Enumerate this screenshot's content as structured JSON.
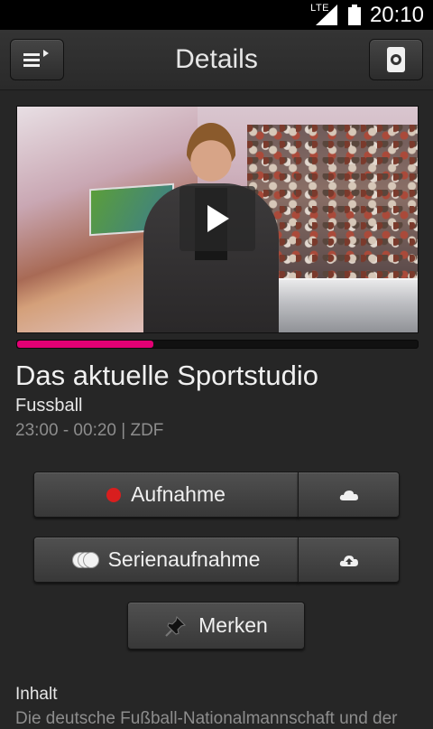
{
  "status_bar": {
    "network": "LTE",
    "time": "20:10"
  },
  "header": {
    "title": "Details",
    "menu_icon": "menu-icon",
    "remote_icon": "remote-icon"
  },
  "video": {
    "play_icon": "play-icon",
    "progress_percent": 34
  },
  "program": {
    "title": "Das aktuelle Sportstudio",
    "genre": "Fussball",
    "time_channel": "23:00 - 00:20  |  ZDF"
  },
  "actions": {
    "record_label": "Aufnahme",
    "series_label": "Serienaufnahme",
    "bookmark_label": "Merken",
    "cloud_icon": "cloud-icon",
    "cloud_upload_icon": "cloud-upload-icon"
  },
  "content": {
    "heading": "Inhalt",
    "text": "Die deutsche Fußball-Nationalmannschaft und der"
  },
  "colors": {
    "accent": "#e20074",
    "record": "#d81e1e",
    "background": "#262626"
  }
}
